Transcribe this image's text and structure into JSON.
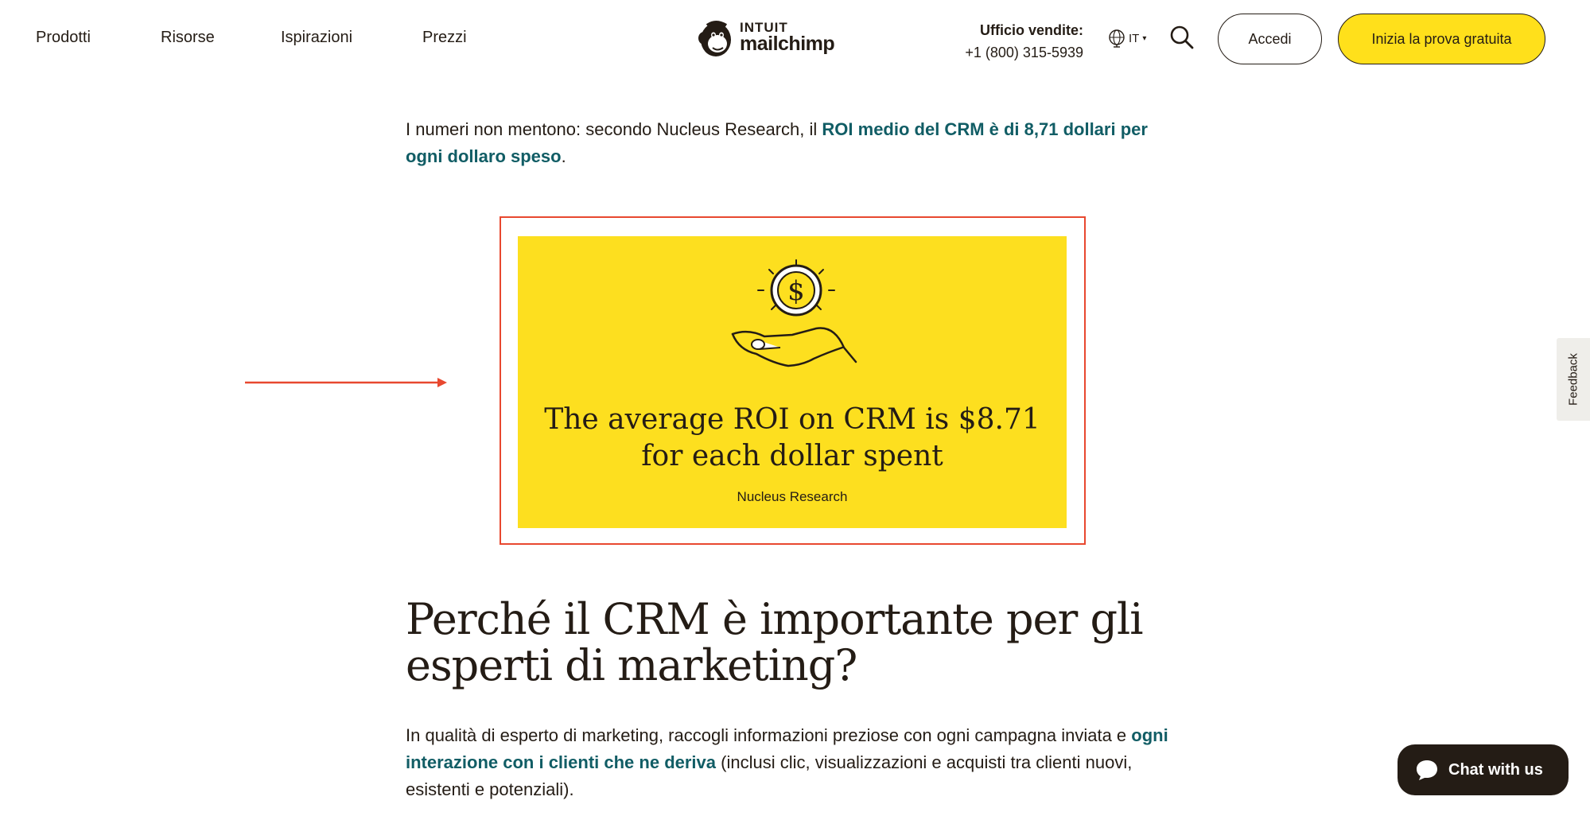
{
  "header": {
    "nav": [
      "Prodotti",
      "Risorse",
      "Ispirazioni",
      "Prezzi"
    ],
    "logo": {
      "top": "INTUIT",
      "bottom": "mailchimp",
      "icon": "mailchimp-freddie-icon"
    },
    "sales": {
      "title": "Ufficio vendite:",
      "phone": "+1 (800) 315-5939"
    },
    "language": {
      "code": "IT",
      "icon": "globe-icon"
    },
    "search_icon": "search-icon",
    "login_label": "Accedi",
    "trial_label": "Inizia la prova gratuita"
  },
  "content": {
    "p1": {
      "before": "I numeri non mentono: secondo Nucleus Research, il ",
      "link": "ROI medio del CRM è di 8,71 dollari per ogni dollaro speso",
      "after": "."
    },
    "card": {
      "headline_line1": "The average ROI on CRM is $8.71",
      "headline_line2": "for each dollar spent",
      "source": "Nucleus Research",
      "icon": "hand-holding-coin-icon",
      "background": "#fddf1f"
    },
    "heading": "Perché il CRM è importante per gli esperti di marketing?",
    "p2": {
      "before": "In qualità di esperto di marketing, raccogli informazioni preziose con ogni campagna inviata e ",
      "link": "ogni interazione con i clienti che ne deriva",
      "after": " (inclusi clic, visualizzazioni e acquisti tra clienti nuovi, esistenti e potenziali)."
    }
  },
  "annotation": {
    "color": "#e8482f"
  },
  "feedback_label": "Feedback",
  "chat_label": "Chat with us",
  "colors": {
    "brand_yellow": "#ffe01b",
    "link": "#115d65",
    "text": "#241c15"
  }
}
